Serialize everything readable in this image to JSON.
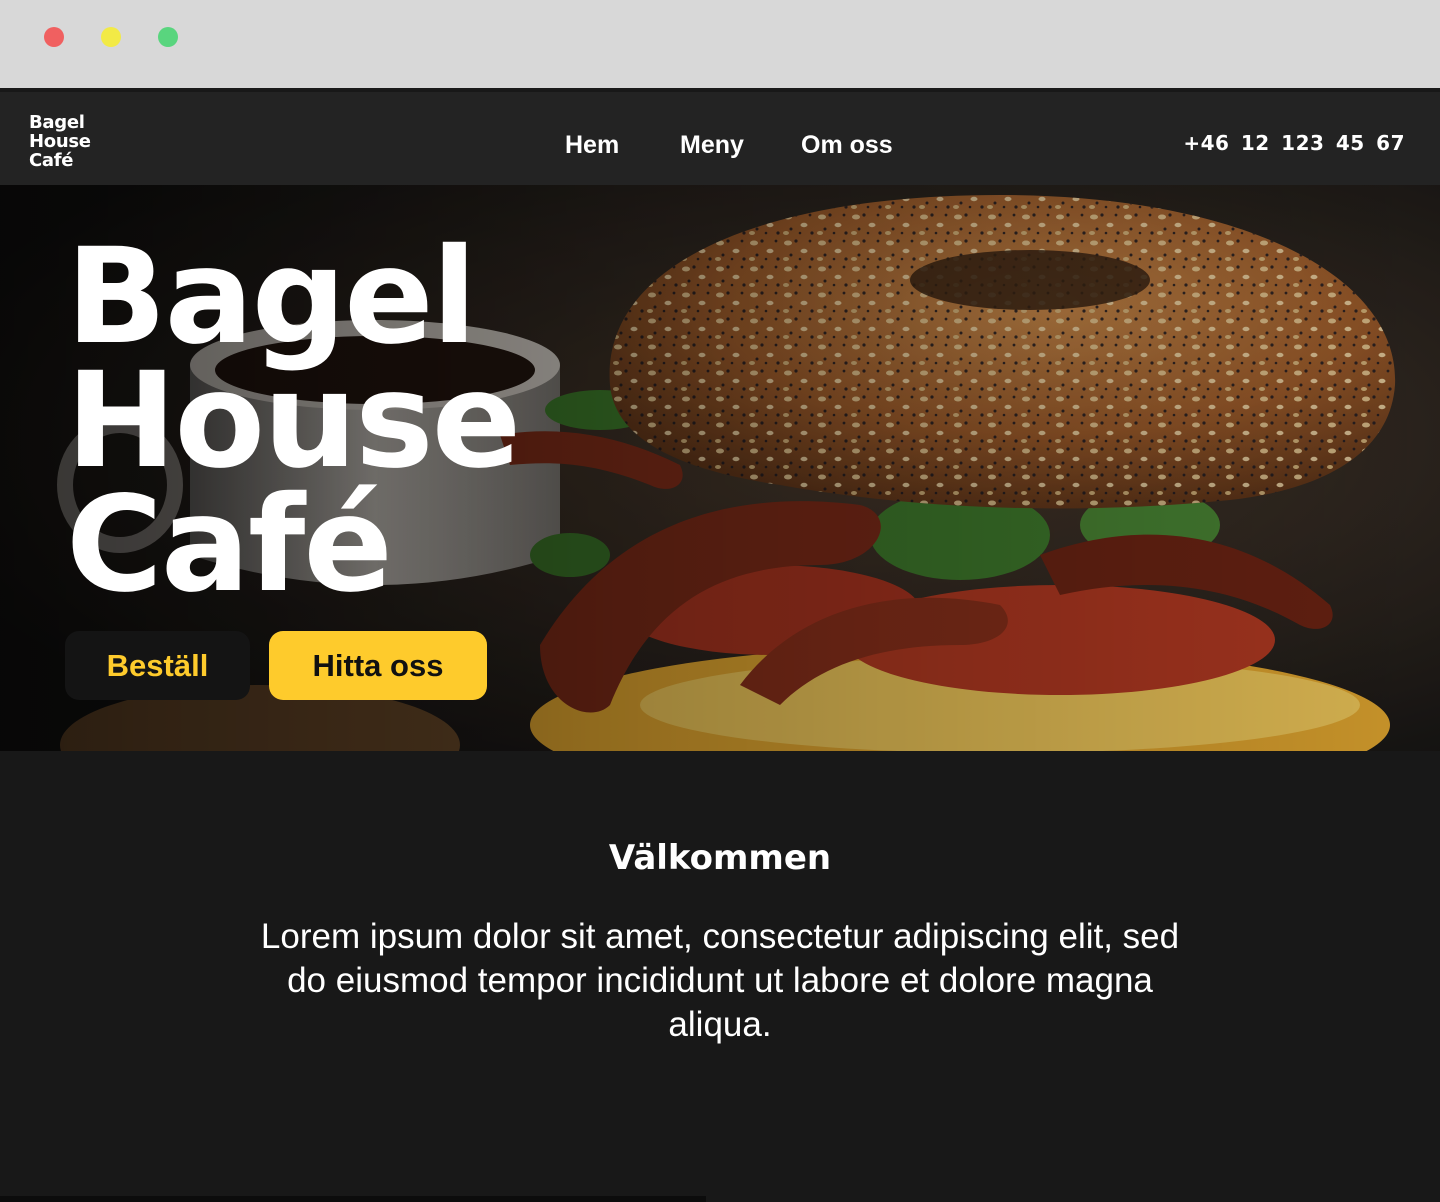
{
  "window": {
    "controls": [
      "close",
      "minimize",
      "maximize"
    ]
  },
  "header": {
    "logo_lines": [
      "Bagel",
      "House",
      "Café"
    ],
    "nav": {
      "hem": "Hem",
      "meny": "Meny",
      "om_oss": "Om oss"
    },
    "phone": "+46 12 123 45 67"
  },
  "hero": {
    "title_lines": [
      "Bagel",
      "House",
      "Café"
    ],
    "order_button": "Beställ",
    "find_button": "Hitta oss",
    "image": "bagel-sandwich-with-bacon-tomato-arugula-and-coffee-cup"
  },
  "welcome": {
    "title": "Välkommen",
    "text": "Lorem ipsum dolor sit amet, consectetur adipiscing elit, sed do eiusmod tempor incididunt ut labore et dolore magna aliqua."
  },
  "colors": {
    "accent": "#fecb2c",
    "background": "#181818",
    "header": "#232323",
    "chrome": "#d8d8d8"
  }
}
